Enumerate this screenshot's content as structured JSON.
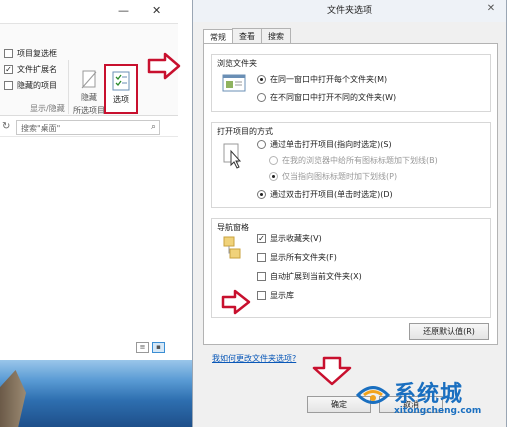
{
  "explorer": {
    "window_controls": {
      "minimize": "—",
      "close": "✕"
    },
    "ribbon": {
      "checkboxes": [
        {
          "label": "项目复选框",
          "checked": false
        },
        {
          "label": "文件扩展名",
          "checked": true
        },
        {
          "label": "隐藏的项目",
          "checked": false
        }
      ],
      "hide_label": "隐藏",
      "hide_sub_label": "所选项目",
      "options_label": "选项",
      "group_label": "显示/隐藏"
    },
    "search_placeholder": "搜索\"桌面\""
  },
  "dialog": {
    "title": "文件夹选项",
    "close_label": "✕",
    "tabs": [
      "常规",
      "查看",
      "搜索"
    ],
    "browse": {
      "title": "浏览文件夹",
      "options": [
        {
          "label": "在同一窗口中打开每个文件夹(M)",
          "selected": true
        },
        {
          "label": "在不同窗口中打开不同的文件夹(W)",
          "selected": false
        }
      ]
    },
    "click": {
      "title": "打开项目的方式",
      "options": [
        {
          "label": "通过单击打开项目(指向时选定)(S)",
          "selected": false
        },
        {
          "label": "在我的浏览器中给所有图标标题加下划线(B)",
          "selected": false,
          "disabled": true
        },
        {
          "label": "仅当指向图标标题时加下划线(P)",
          "selected": true,
          "disabled": true
        },
        {
          "label": "通过双击打开项目(单击时选定)(D)",
          "selected": true
        }
      ]
    },
    "nav": {
      "title": "导航窗格",
      "options": [
        {
          "label": "显示收藏夹(V)",
          "checked": true
        },
        {
          "label": "显示所有文件夹(F)",
          "checked": false
        },
        {
          "label": "自动扩展到当前文件夹(X)",
          "checked": false
        },
        {
          "label": "显示库",
          "checked": false
        }
      ]
    },
    "restore_defaults": "还原默认值(R)",
    "help_link": "我如何更改文件夹选项?",
    "ok": "确定",
    "cancel": "取消"
  },
  "watermark": {
    "text": "系统城",
    "sub": "xitongcheng.com"
  },
  "colors": {
    "accent_red": "#c8102e",
    "link_blue": "#0a58b8",
    "watermark_blue": "#1a6fc0"
  }
}
